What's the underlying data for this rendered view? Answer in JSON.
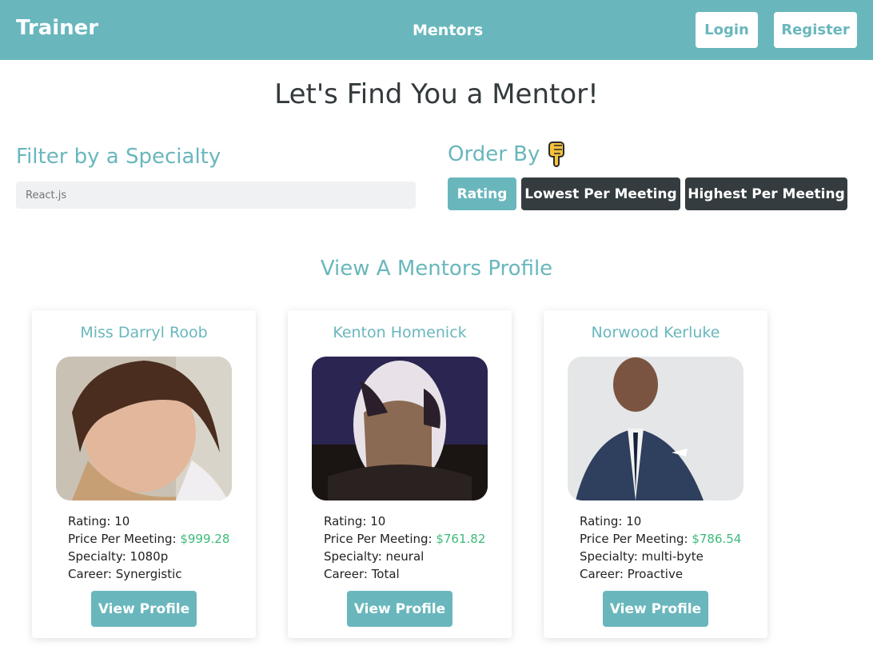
{
  "navbar": {
    "brand": "Trainer",
    "link": "Mentors",
    "login_label": "Login",
    "register_label": "Register"
  },
  "page": {
    "title": "Let's Find You a Mentor!"
  },
  "filter": {
    "heading": "Filter by a Specialty",
    "placeholder": "React.js"
  },
  "order": {
    "heading": "Order By",
    "icon": "pointing-down-hand-icon",
    "buttons": [
      "Rating",
      "Lowest Per Meeting",
      "Highest Per Meeting"
    ],
    "active": "Rating"
  },
  "section": {
    "title": "View A Mentors Profile"
  },
  "labels": {
    "rating": "Rating: ",
    "price": "Price Per Meeting: ",
    "specialty": "Specialty: ",
    "career": "Career: ",
    "view_profile": "View Profile"
  },
  "mentors": [
    {
      "name": "Miss Darryl Roob",
      "rating": "10",
      "price": "$999.28",
      "specialty": "1080p",
      "career": "Synergistic"
    },
    {
      "name": "Kenton Homenick",
      "rating": "10",
      "price": "$761.82",
      "specialty": "neural",
      "career": "Total"
    },
    {
      "name": "Norwood Kerluke",
      "rating": "10",
      "price": "$786.54",
      "specialty": "multi-byte",
      "career": "Proactive"
    }
  ],
  "colors": {
    "accent": "#69b7bd",
    "dark_button": "#343c3f",
    "price": "#3dba7a"
  }
}
